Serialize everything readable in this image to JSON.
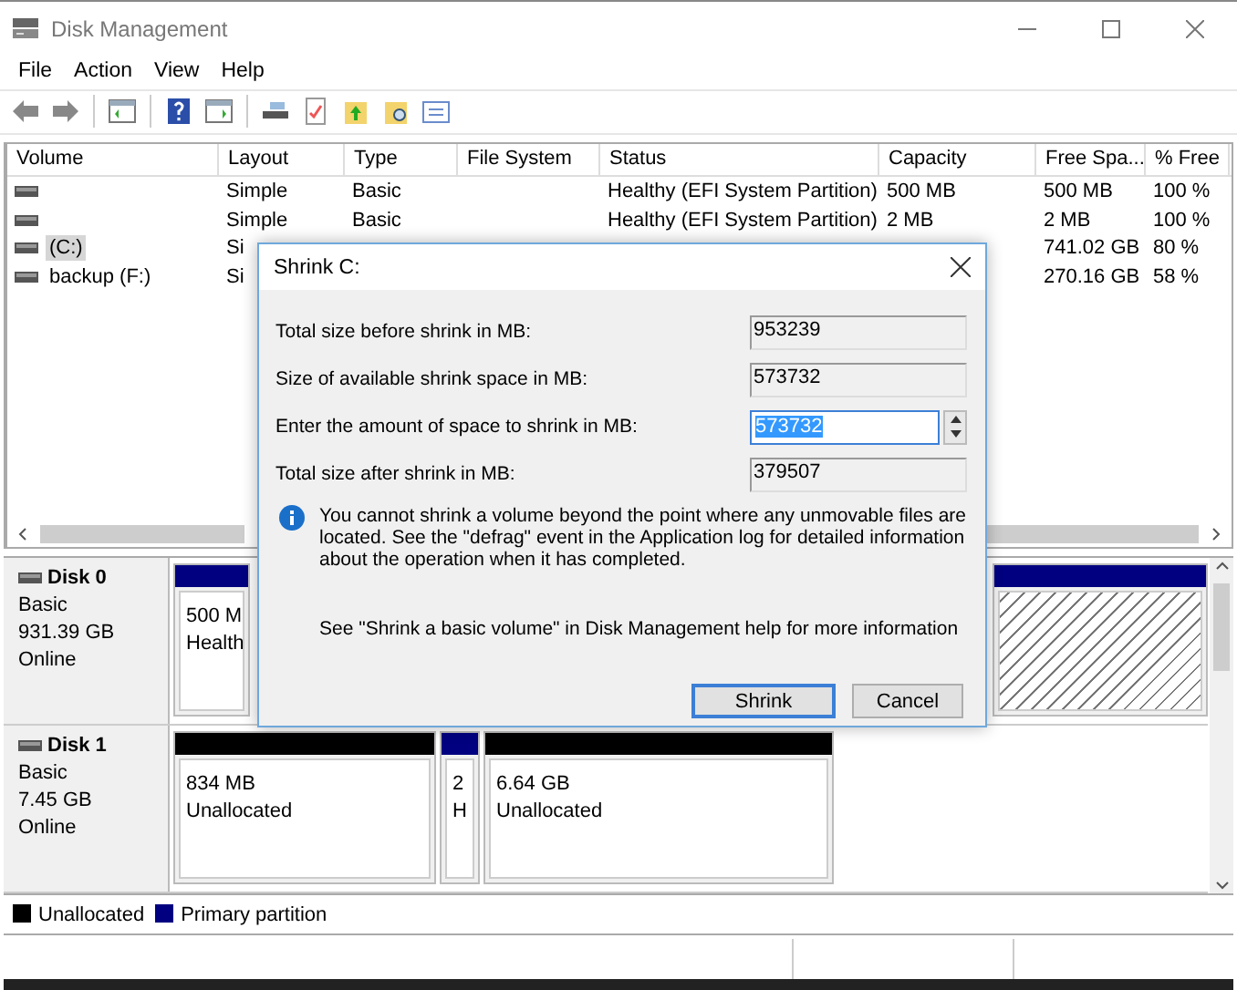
{
  "window": {
    "title": "Disk Management"
  },
  "menu": [
    "File",
    "Action",
    "View",
    "Help"
  ],
  "volume_table": {
    "columns": [
      "Volume",
      "Layout",
      "Type",
      "File System",
      "Status",
      "Capacity",
      "Free Spa...",
      "% Free"
    ],
    "rows": [
      {
        "selected": false,
        "cells": [
          "",
          "Simple",
          "Basic",
          "",
          "Healthy (EFI System Partition)",
          "500 MB",
          "500 MB",
          "100 %"
        ]
      },
      {
        "selected": false,
        "cells": [
          "",
          "Simple",
          "Basic",
          "",
          "Healthy (EFI System Partition)",
          "2 MB",
          "2 MB",
          "100 %"
        ]
      },
      {
        "selected": true,
        "cells": [
          "(C:)",
          "Si",
          "",
          "",
          "",
          "",
          "741.02 GB",
          "80 %"
        ]
      },
      {
        "selected": false,
        "cells": [
          "backup (F:)",
          "Si",
          "",
          "",
          "",
          "",
          "270.16 GB",
          "58 %"
        ]
      }
    ]
  },
  "disks": [
    {
      "name": "Disk 0",
      "lines": [
        "Basic",
        "931.39 GB",
        "Online"
      ],
      "partitions": [
        {
          "color": "#000080",
          "selected": false,
          "lines": [
            "500 M",
            "Health"
          ]
        },
        {
          "color": "#000080",
          "selected": true
        }
      ]
    },
    {
      "name": "Disk 1",
      "lines": [
        "Basic",
        "7.45 GB",
        "Online"
      ],
      "partitions": [
        {
          "color": "#000000",
          "selected": false,
          "lines": [
            "834 MB",
            "Unallocated"
          ]
        },
        {
          "color": "#000080",
          "selected": false,
          "lines": [
            "2",
            "H"
          ]
        },
        {
          "color": "#000000",
          "selected": false,
          "lines": [
            "6.64 GB",
            "Unallocated"
          ]
        }
      ]
    }
  ],
  "legend": [
    {
      "label": "Unallocated",
      "color": "#000000"
    },
    {
      "label": "Primary partition",
      "color": "#000080"
    }
  ],
  "dialog": {
    "title": "Shrink C:",
    "fields": [
      {
        "kind": "readonly",
        "label": "Total size before shrink in MB:",
        "value": "953239"
      },
      {
        "kind": "readonly",
        "label": "Size of available shrink space in MB:",
        "value": "573732"
      },
      {
        "kind": "spin",
        "label": "Enter the amount of space to shrink in MB:",
        "value": "573732",
        "highlighted": true
      },
      {
        "kind": "readonly",
        "label": "Total size after shrink in MB:",
        "value": "379507"
      }
    ],
    "info": "You cannot shrink a volume beyond the point where any unmovable files are located. See the \"defrag\" event in the Application log for detailed information about the operation when it has completed.",
    "help": "See \"Shrink a basic volume\" in Disk Management help for more information",
    "buttons": [
      {
        "label": "Shrink",
        "default": true
      },
      {
        "label": "Cancel",
        "default": false
      }
    ]
  }
}
